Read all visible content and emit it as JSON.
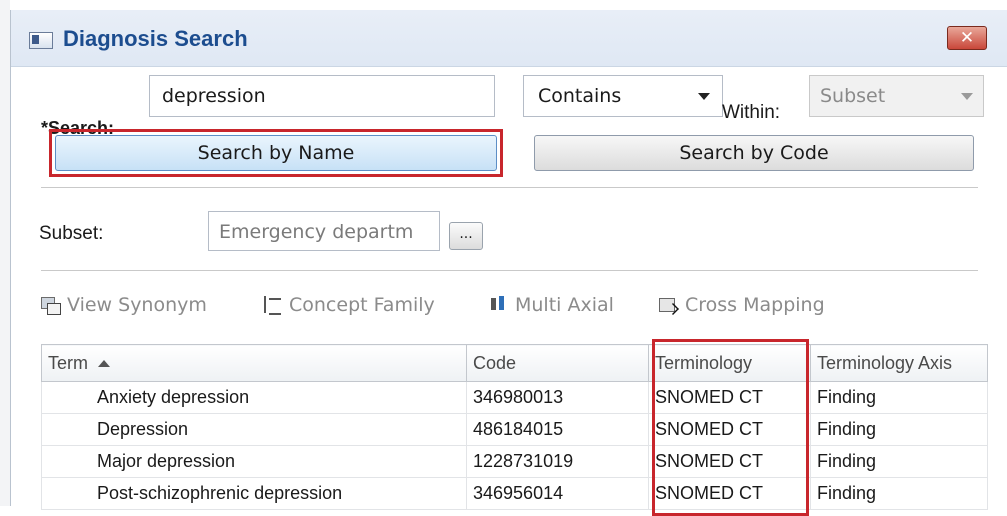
{
  "window": {
    "title": "Diagnosis Search",
    "close_label": "✕"
  },
  "search": {
    "label": "*Search:",
    "value": "depression",
    "match_mode": "Contains",
    "within_label": "Within:",
    "within_value": "Subset"
  },
  "buttons": {
    "search_by_name": "Search by Name",
    "search_by_code": "Search by Code"
  },
  "subset": {
    "label": "Subset:",
    "value": "Emergency departm",
    "browse_label": "..."
  },
  "toolbar": {
    "view_synonym": "View Synonym",
    "concept_family": "Concept Family",
    "multi_axial": "Multi Axial",
    "cross_mapping": "Cross Mapping"
  },
  "table": {
    "columns": [
      "Term",
      "Code",
      "Terminology",
      "Terminology Axis"
    ],
    "sort_column": "Term",
    "rows": [
      {
        "term": "Anxiety depression",
        "code": "346980013",
        "terminology": "SNOMED CT",
        "axis": "Finding"
      },
      {
        "term": "Depression",
        "code": "486184015",
        "terminology": "SNOMED CT",
        "axis": "Finding"
      },
      {
        "term": "Major depression",
        "code": "1228731019",
        "terminology": "SNOMED CT",
        "axis": "Finding"
      },
      {
        "term": "Post-schizophrenic depression",
        "code": "346956014",
        "terminology": "SNOMED CT",
        "axis": "Finding"
      }
    ]
  },
  "colors": {
    "title_text": "#1c4d8f",
    "highlight_border": "#c8262c",
    "toolbar_disabled_text": "#8b8b8b"
  }
}
